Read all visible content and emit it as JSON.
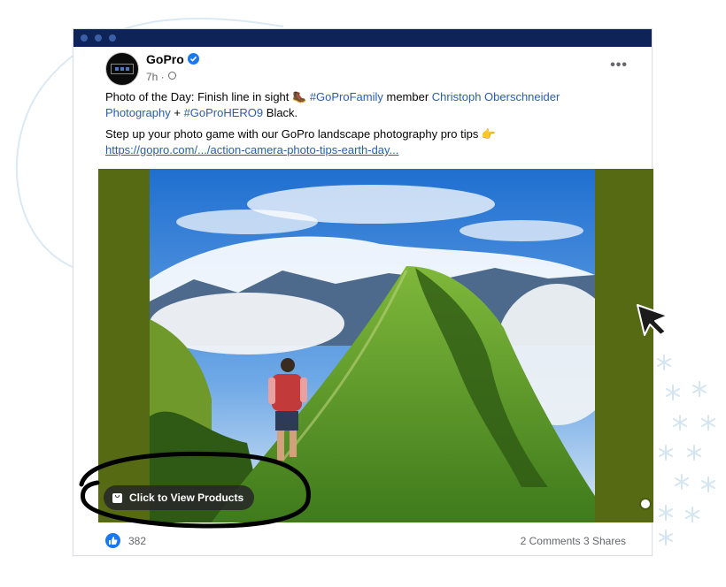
{
  "post": {
    "author": "GoPro",
    "time": "7h ·",
    "more": "•••",
    "line1_a": "Photo of the Day: Finish line in sight 🥾 ",
    "hashtag1": "#GoProFamily",
    "line1_b": " member ",
    "mention": "Christoph Oberschneider Photography",
    "line1_c": " + ",
    "hashtag2": "#GoProHERO9",
    "line1_d": " Black.",
    "line2": "Step up your photo game with our GoPro landscape photography pro tips 👉",
    "url": "https://gopro.com/.../action-camera-photo-tips-earth-day..."
  },
  "media": {
    "products_button": "Click to View Products"
  },
  "footer": {
    "likes": "382",
    "comments": "2 Comments",
    "shares": "3 Shares"
  },
  "colors": {
    "titlebar": "#0e2458",
    "media_background": "#566a14",
    "link": "#2a5db0",
    "like": "#1877f2"
  },
  "icons": [
    "verified-badge-icon",
    "globe-icon",
    "more-options-icon",
    "shopping-bag-icon",
    "like-icon",
    "cursor-arrow-icon"
  ]
}
